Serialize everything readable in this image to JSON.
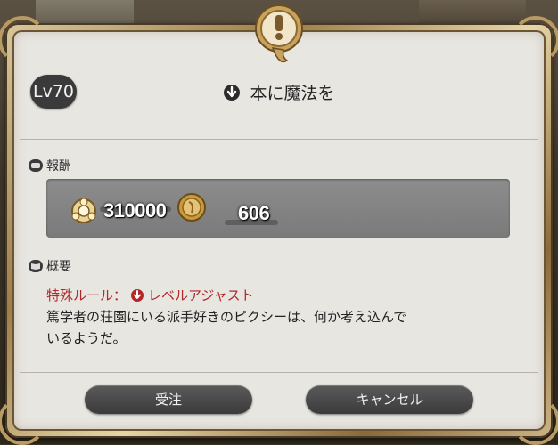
{
  "level_badge": "Lv70",
  "quest_title": "本に魔法を",
  "rewards_section": {
    "label": "報酬",
    "icon": "scroll-icon"
  },
  "rewards": [
    {
      "name": "experience",
      "icon": "experience-icon",
      "value": "310000"
    },
    {
      "name": "gil",
      "icon": "gil-coin-icon",
      "value": "606"
    }
  ],
  "summary_section": {
    "label": "概要",
    "icon": "book-icon"
  },
  "summary": {
    "special_rule_label": "特殊ルール：",
    "special_rule_value": "レベルアジャスト",
    "description_line1": "篤学者の荘園にいる派手好きのピクシーは、何か考え込んで",
    "description_line2": "いるようだ。"
  },
  "buttons": {
    "accept": "受注",
    "cancel": "キャンセル"
  },
  "colors": {
    "special_rule": "#b0282a",
    "frame_gold": "#c8ad78",
    "panel": "#e8e6e1"
  }
}
